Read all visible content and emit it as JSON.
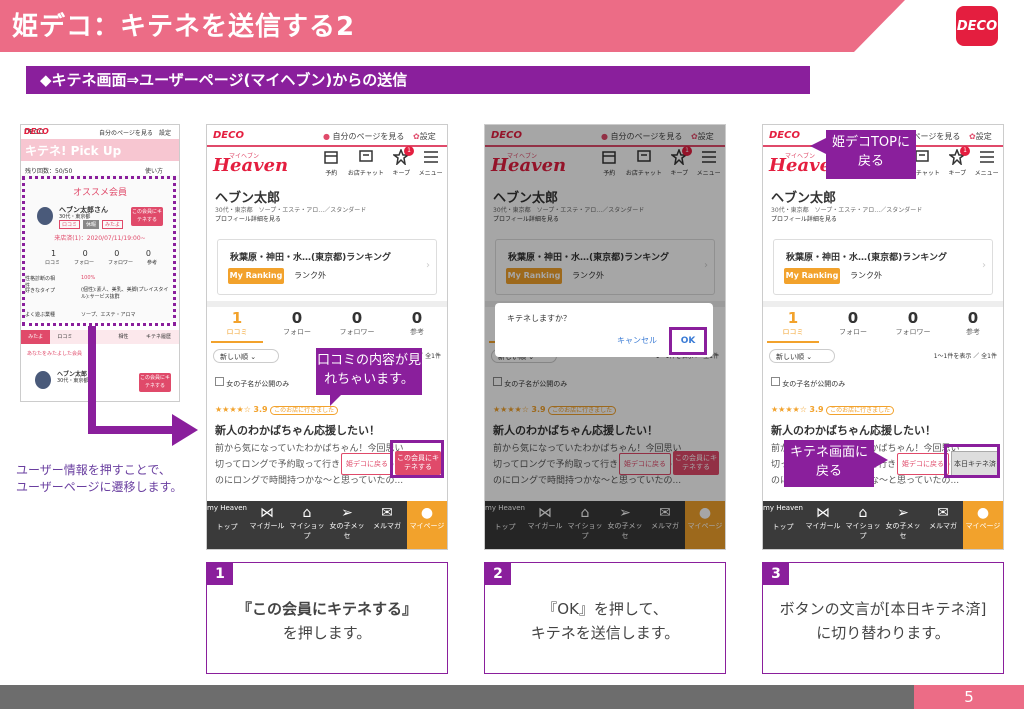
{
  "header": {
    "title": "姫デコ：キテネを送信する2",
    "logo_text": "DECO"
  },
  "subheader": {
    "text": "◆キテネ画面⇒ユーザーページ(マイヘブン)からの送信"
  },
  "side_note": {
    "line1": "ユーザー情報を押すことで、",
    "line2": "ユーザーページに遷移します。"
  },
  "thumb": {
    "top_left": "DECO",
    "mypage": "自分のページを見る",
    "settings": "設定",
    "title": "キテネ! Pick Up",
    "remaining": "残り回数：50/50",
    "usage": "使い方",
    "section": "オススメ会員",
    "user": "ヘブン太郎さん",
    "user_meta": "30代・東京都",
    "badges": [
      "ロコミ",
      "休暇",
      "みたよ"
    ],
    "kitene_btn": "この会員にキテネする",
    "visit": "来店済(1)：2020/07/11/19:00~",
    "stats": [
      {
        "n": "1",
        "l": "ロコミ"
      },
      {
        "n": "0",
        "l": "フォロー"
      },
      {
        "n": "0",
        "l": "フォロワー"
      },
      {
        "n": "0",
        "l": "参考"
      }
    ],
    "info": [
      {
        "k": "性格診断の相性",
        "v": "100%"
      },
      {
        "k": "好きなタイプ",
        "v": "(個性):素人、美乳、美脚(プレイスタイル):サービス抜群"
      },
      {
        "k": "よく遊ぶ業種",
        "v": "ソープ、エステ・アロマ"
      }
    ],
    "tabs": [
      "みたよ",
      "ロコミ",
      "フ",
      "相性",
      "キテネ履歴"
    ],
    "list_head": "あなたをみたよした会員",
    "user2": "ヘブン太郎",
    "user2_meta": "30代・東京都",
    "kitene_btn2": "この会員にキテネする"
  },
  "phone": {
    "deco": "DECO",
    "mypage": "自分のページを見る",
    "settings": "設定",
    "brand_small": "マイヘブン",
    "brand": "Heaven",
    "top_icons": [
      {
        "icon": "calendar-icon",
        "label": "予約"
      },
      {
        "icon": "chat-icon",
        "label": "お店チャット"
      },
      {
        "icon": "star-icon",
        "label": "キープ"
      },
      {
        "icon": "menu-icon",
        "label": "メニュー"
      }
    ],
    "badge_count": "1",
    "user_name": "ヘブン太郎",
    "user_meta": "30代・東京都　ソープ・エステ・アロ…／スタンダード",
    "profile_link": "プロフィール詳細を見る",
    "ranking_title": "秋葉原・神田・水…(東京都)ランキング",
    "my_ranking": "My Ranking",
    "rank_value": "ランク外",
    "stats": [
      {
        "n": "1",
        "l": "ロコミ"
      },
      {
        "n": "0",
        "l": "フォロー"
      },
      {
        "n": "0",
        "l": "フォロワー"
      },
      {
        "n": "0",
        "l": "参考"
      }
    ],
    "sort": "新しい順",
    "count": "1〜1件を表示 ／ 全1件",
    "filter": "女の子名が公開のみ",
    "rating": "3.9",
    "visited": "このお店に行きました",
    "review_title": "新人のわかばちゃん応援したい！",
    "review_lines": [
      "前から気になっていたわかばちゃん！今回思い",
      "切ってロングで予約取って行きました。初めて",
      "のにロングで時間持つかな〜と思っていたの..."
    ],
    "back_btn": "姫デコに戻る",
    "kitene_btn": "この会員にキテネする",
    "done_btn": "本日キテネ済",
    "nav": [
      {
        "icon": "heaven-icon",
        "label": "トップ"
      },
      {
        "icon": "ribbon-icon",
        "label": "マイガール"
      },
      {
        "icon": "shop-icon",
        "label": "マイショップ"
      },
      {
        "icon": "send-icon",
        "label": "女の子メッセ"
      },
      {
        "icon": "mail-icon",
        "label": "メルマガ"
      },
      {
        "icon": "user-icon",
        "label": "マイページ"
      }
    ],
    "nav_logo": "my Heaven"
  },
  "callouts": {
    "review": "口コミの内容が見れちゃいます。",
    "top": "姫デコTOPに戻る",
    "back": "キテネ画面に戻る"
  },
  "dialog": {
    "message": "キテネしますか？",
    "cancel": "キャンセル",
    "ok": "OK"
  },
  "steps": [
    {
      "num": "1",
      "line1": "『この会員にキテネする』",
      "line2": "を押します。"
    },
    {
      "num": "2",
      "line1": "『OK』を押して、",
      "line2": "キテネを送信します。"
    },
    {
      "num": "3",
      "line1": "ボタンの文言が[本日キテネ済]",
      "line2": "に切り替わります。"
    }
  ],
  "page_number": "5"
}
